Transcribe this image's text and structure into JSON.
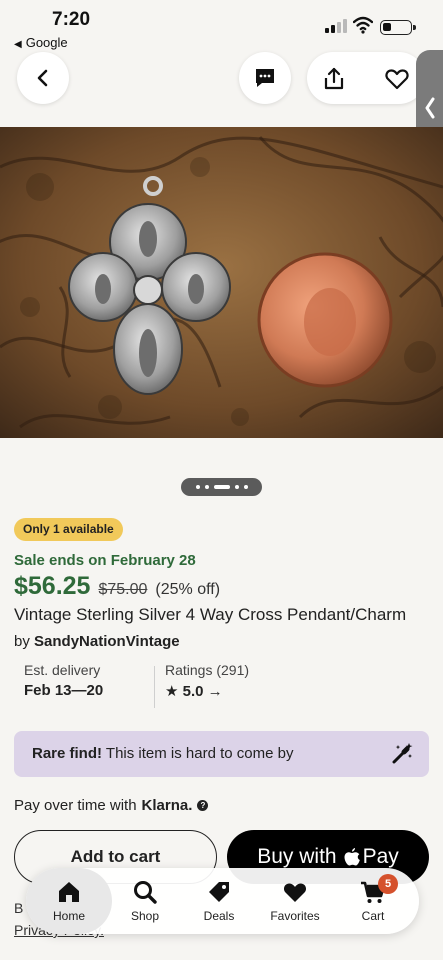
{
  "status_bar": {
    "time": "7:20",
    "back_app": "Google"
  },
  "nav": {
    "icons": [
      "back-arrow-icon",
      "message-icon",
      "share-icon",
      "heart-icon",
      "side-handle-chevron-icon"
    ]
  },
  "listing": {
    "availability_badge": "Only 1 available",
    "sale_ends": "Sale ends on February 28",
    "price": "$56.25",
    "original_price": "$75.00",
    "discount": "(25% off)",
    "title": "Vintage Sterling Silver 4 Way Cross Pendant/Charm",
    "seller_prefix": "by",
    "seller": "SandyNationVintage",
    "delivery_label": "Est. delivery",
    "delivery_value": "Feb 13—20",
    "ratings_label": "Ratings (291)",
    "rating_value": "5.0",
    "rare_bold": "Rare find!",
    "rare_text": "This item is hard to come by",
    "pay_over_time": "Pay over time with",
    "klarna_brand": "Klarna.",
    "add_to_cart": "Add to cart",
    "buy_with": "Buy with",
    "pay": "Pay",
    "policy_prefix": "B",
    "policy_link": "Privacy Policy."
  },
  "colors": {
    "accent_green": "#2f6a3a",
    "badge_yellow": "#f1c95a",
    "rare_bg": "#dcd3e8",
    "cart_badge": "#d5512c"
  },
  "tabbar": {
    "tabs": [
      {
        "label": "Home",
        "icon": "home-icon"
      },
      {
        "label": "Shop",
        "icon": "search-icon"
      },
      {
        "label": "Deals",
        "icon": "tag-icon"
      },
      {
        "label": "Favorites",
        "icon": "heart-icon"
      },
      {
        "label": "Cart",
        "icon": "cart-icon"
      }
    ],
    "cart_count": "5"
  }
}
